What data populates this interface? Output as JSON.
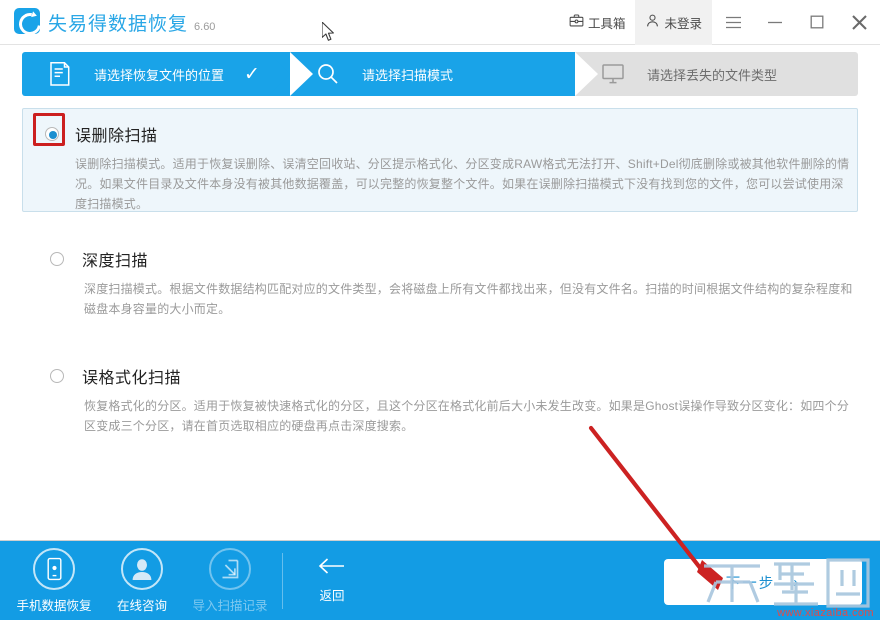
{
  "window": {
    "brand_name": "失易得数据恢复",
    "version": "6.60",
    "toolbox_label": "工具箱",
    "login_label": "未登录",
    "menu_icon": "hamburger-icon",
    "minimize_icon": "minimize-icon",
    "maximize_icon": "maximize-icon",
    "close_icon": "close-icon",
    "toolbox_icon": "toolbox-icon",
    "user_icon": "user-icon",
    "logo_icon": "app-logo-icon"
  },
  "steps": [
    {
      "label": "请选择恢复文件的位置",
      "state": "done",
      "icon": "document-icon",
      "check": "✓"
    },
    {
      "label": "请选择扫描模式",
      "state": "current",
      "icon": "search-icon"
    },
    {
      "label": "请选择丢失的文件类型",
      "state": "todo",
      "icon": "monitor-icon"
    }
  ],
  "options": [
    {
      "title": "误删除扫描",
      "selected": true,
      "desc": "误删除扫描模式。适用于恢复误删除、误清空回收站、分区提示格式化、分区变成RAW格式无法打开、Shift+Del彻底删除或被其他软件删除的情况。如果文件目录及文件本身没有被其他数据覆盖，可以完整的恢复整个文件。如果在误删除扫描模式下没有找到您的文件，您可以尝试使用深度扫描模式。"
    },
    {
      "title": "深度扫描",
      "selected": false,
      "desc": "深度扫描模式。根据文件数据结构匹配对应的文件类型，会将磁盘上所有文件都找出来，但没有文件名。扫描的时间根据文件结构的复杂程度和磁盘本身容量的大小而定。"
    },
    {
      "title": "误格式化扫描",
      "selected": false,
      "desc": "恢复格式化的分区。适用于恢复被快速格式化的分区，且这个分区在格式化前后大小未发生改变。如果是Ghost误操作导致分区变化：如四个分区变成三个分区，请在首页选取相应的硬盘再点击深度搜索。"
    }
  ],
  "bottom": {
    "tools": [
      {
        "label": "手机数据恢复",
        "icon": "mobile-phone-icon",
        "disabled": false
      },
      {
        "label": "在线咨询",
        "icon": "person-avatar-icon",
        "disabled": false
      },
      {
        "label": "导入扫描记录",
        "icon": "import-record-icon",
        "disabled": true
      }
    ],
    "back_label": "返回",
    "back_icon": "left-arrow-icon",
    "next_label": "下一步",
    "next_chevron": "›"
  },
  "annotations": {
    "redbox_target": "误删除扫描 radio",
    "arrow_target": "下一步 button",
    "accent_color": "#19a3e8",
    "bottom_bar_color": "#139ce4",
    "selected_panel_bg": "#eef6fb",
    "annotation_red": "#cc1f1f"
  },
  "watermark": {
    "text": "下载吧",
    "url": "www.xiazaiba.com"
  }
}
